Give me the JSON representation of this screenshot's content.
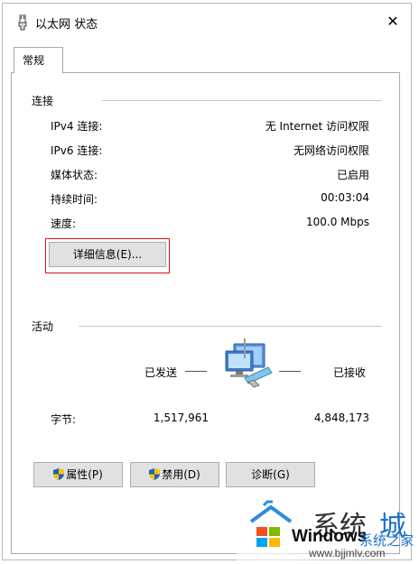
{
  "window": {
    "title": "以太网 状态",
    "close_symbol": "✕"
  },
  "tabs": [
    {
      "label": "常规",
      "selected": true
    }
  ],
  "connection": {
    "group_label": "连接",
    "rows": [
      {
        "label": "IPv4 连接:",
        "value": "无 Internet 访问权限"
      },
      {
        "label": "IPv6 连接:",
        "value": "无网络访问权限"
      },
      {
        "label": "媒体状态:",
        "value": "已启用"
      },
      {
        "label": "持续时间:",
        "value": "00:03:04"
      },
      {
        "label": "速度:",
        "value": "100.0 Mbps"
      }
    ],
    "details_button": "详细信息(E)..."
  },
  "activity": {
    "group_label": "活动",
    "sent_label": "已发送",
    "received_label": "已接收",
    "bytes_label": "字节:",
    "bytes_sent": "1,517,961",
    "bytes_received": "4,848,173"
  },
  "buttons": {
    "properties": "属性(P)",
    "disable": "禁用(D)",
    "diagnose": "诊断(G)"
  },
  "watermark": {
    "glyph1": "系统",
    "glyph2": "城",
    "brand": "Windows",
    "brand_cn": "系统之家",
    "url": "www.bjjmlv.com"
  },
  "colors": {
    "highlight_border": "#e81123",
    "button_face": "#e1e1e1",
    "shield_blue": "#1f5fbf",
    "shield_yellow": "#f6c600"
  }
}
